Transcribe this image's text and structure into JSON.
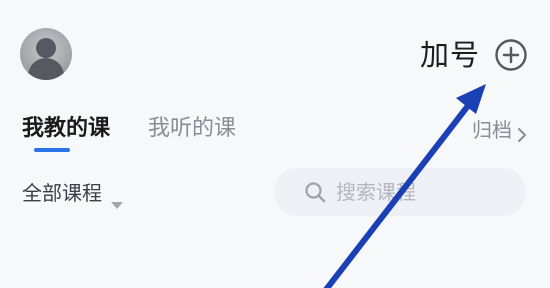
{
  "header": {
    "avatar_icon": "user-avatar-icon",
    "join_label": "加号",
    "add_icon": "plus-circle-icon"
  },
  "tabs": [
    {
      "label": "我教的课",
      "active": true
    },
    {
      "label": "我听的课",
      "active": false
    }
  ],
  "archive": {
    "label": "归档",
    "icon": "chevron-right-icon"
  },
  "filter": {
    "label": "全部课程",
    "icon": "caret-down-icon"
  },
  "search": {
    "placeholder": "搜索课程",
    "icon": "search-icon"
  },
  "colors": {
    "accent": "#2b74e8",
    "annotation_arrow": "#1b3fb5",
    "background": "#f7f8fa",
    "search_bg": "#eef0f5"
  }
}
